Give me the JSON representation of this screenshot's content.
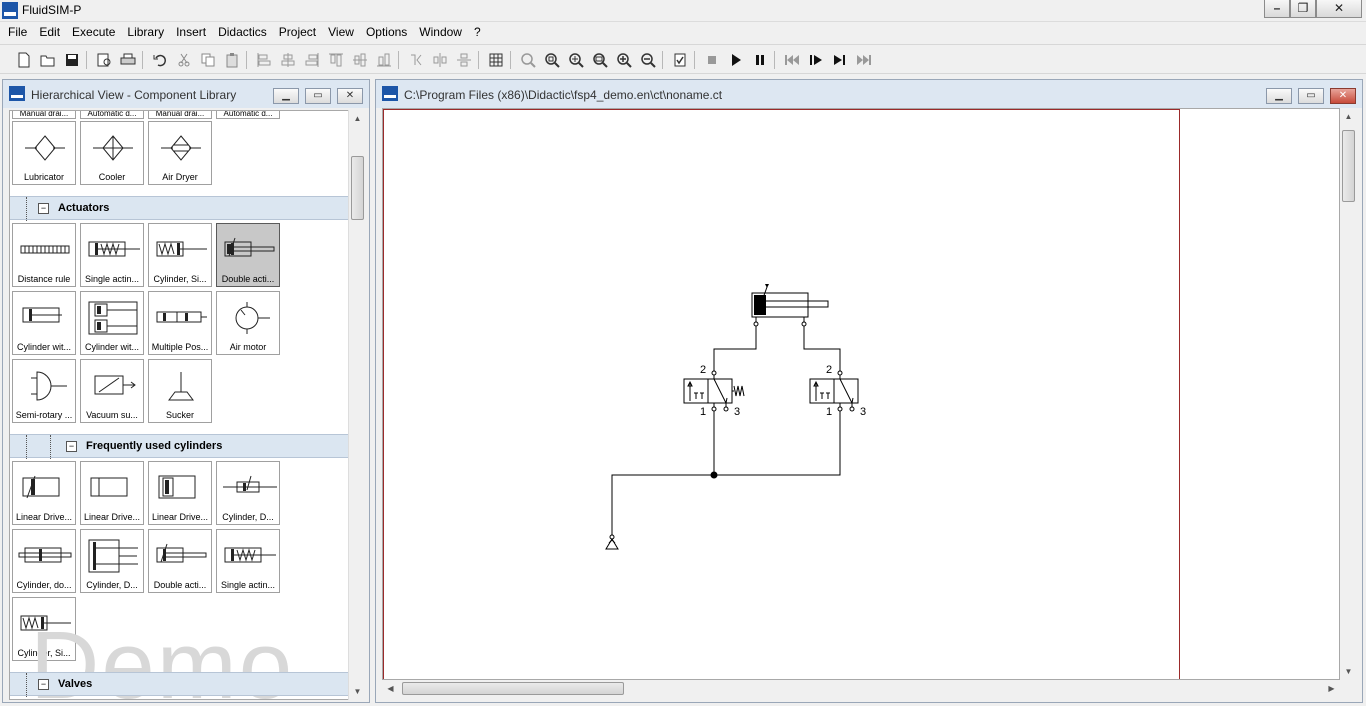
{
  "app": {
    "title": "FluidSIM-P"
  },
  "menu": [
    "File",
    "Edit",
    "Execute",
    "Library",
    "Insert",
    "Didactics",
    "Project",
    "View",
    "Options",
    "Window",
    "?"
  ],
  "toolbar": {
    "icons": [
      "new-icon",
      "open-icon",
      "save-icon",
      "print-preview-icon",
      "print-icon",
      "undo-icon",
      "cut-icon",
      "copy-icon",
      "paste-icon",
      "align-left-icon",
      "align-center-icon",
      "align-right-icon",
      "align-top-icon",
      "align-middle-icon",
      "align-bottom-icon",
      "flip-horizontal-icon",
      "flip-vertical-icon",
      "rotate-icon",
      "grid-icon",
      "zoom-actual-icon",
      "zoom-fit-icon",
      "zoom-window-icon",
      "zoom-region-icon",
      "zoom-in-icon",
      "zoom-out-icon",
      "check-icon",
      "stop-icon",
      "play-icon",
      "pause-icon",
      "reset-icon",
      "step-icon",
      "run-to-end-icon",
      "fast-forward-icon"
    ]
  },
  "library": {
    "title": "Hierarchical View - Component Library",
    "partial_row": [
      "Manual drai...",
      "Automatic d...",
      "Manual drai...",
      "Automatic d..."
    ],
    "row_conditioning": [
      "Lubricator",
      "Cooler",
      "Air Dryer"
    ],
    "groups": {
      "actuators": "Actuators",
      "frequent": "Frequently used cylinders",
      "valves": "Valves"
    },
    "actuators": [
      "Distance rule",
      "Single actin...",
      "Cylinder, Si...",
      "Double acti...",
      "Cylinder wit...",
      "Cylinder wit...",
      "Multiple Pos...",
      "Air motor",
      "Semi-rotary ...",
      "Vacuum su...",
      "Sucker"
    ],
    "frequent": [
      "Linear Drive...",
      "Linear Drive...",
      "Linear Drive...",
      "Cylinder, D...",
      "Cylinder, do...",
      "Cylinder, D...",
      "Double acti...",
      "Single actin...",
      "Cylinder, Si..."
    ],
    "watermark": "Demo"
  },
  "circuit": {
    "title": "C:\\Program Files (x86)\\Didactic\\fsp4_demo.en\\ct\\noname.ct",
    "valve_left": {
      "p2": "2",
      "p1": "1",
      "p3": "3"
    },
    "valve_right": {
      "p2": "2",
      "p1": "1",
      "p3": "3"
    }
  },
  "colors": {
    "page_border": "#9b2a2a",
    "group_bg": "#dbe6f1",
    "selected_tile": "#c8c8c8"
  }
}
